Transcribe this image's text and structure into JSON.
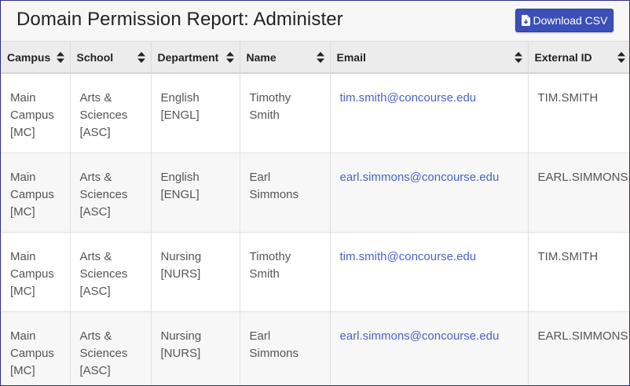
{
  "header": {
    "title": "Domain Permission Report: Administer",
    "download_label": "Download CSV"
  },
  "columns": [
    {
      "label": "Campus"
    },
    {
      "label": "School"
    },
    {
      "label": "Department"
    },
    {
      "label": "Name"
    },
    {
      "label": "Email"
    },
    {
      "label": "External ID"
    }
  ],
  "rows": [
    {
      "campus": [
        "Main",
        "Campus",
        "[MC]"
      ],
      "school": [
        "Arts &",
        "Sciences",
        "[ASC]"
      ],
      "department": [
        "English",
        "[ENGL]"
      ],
      "name": [
        "Timothy",
        "Smith"
      ],
      "email": "tim.smith@concourse.edu",
      "external_id": "TIM.SMITH"
    },
    {
      "campus": [
        "Main",
        "Campus",
        "[MC]"
      ],
      "school": [
        "Arts &",
        "Sciences",
        "[ASC]"
      ],
      "department": [
        "English",
        "[ENGL]"
      ],
      "name": [
        "Earl",
        "Simmons"
      ],
      "email": "earl.simmons@concourse.edu",
      "external_id": "EARL.SIMMONS"
    },
    {
      "campus": [
        "Main",
        "Campus",
        "[MC]"
      ],
      "school": [
        "Arts &",
        "Sciences",
        "[ASC]"
      ],
      "department": [
        "Nursing",
        "[NURS]"
      ],
      "name": [
        "Timothy",
        "Smith"
      ],
      "email": "tim.smith@concourse.edu",
      "external_id": "TIM.SMITH"
    },
    {
      "campus": [
        "Main",
        "Campus",
        "[MC]"
      ],
      "school": [
        "Arts &",
        "Sciences",
        "[ASC]"
      ],
      "department": [
        "Nursing",
        "[NURS]"
      ],
      "name": [
        "Earl",
        "Simmons"
      ],
      "email": "earl.simmons@concourse.edu",
      "external_id": "EARL.SIMMONS"
    }
  ],
  "icons": {
    "download": "file-download-icon",
    "sort": "sort-icon"
  },
  "colors": {
    "accent": "#3b4fb8",
    "link": "#4a63c9"
  }
}
